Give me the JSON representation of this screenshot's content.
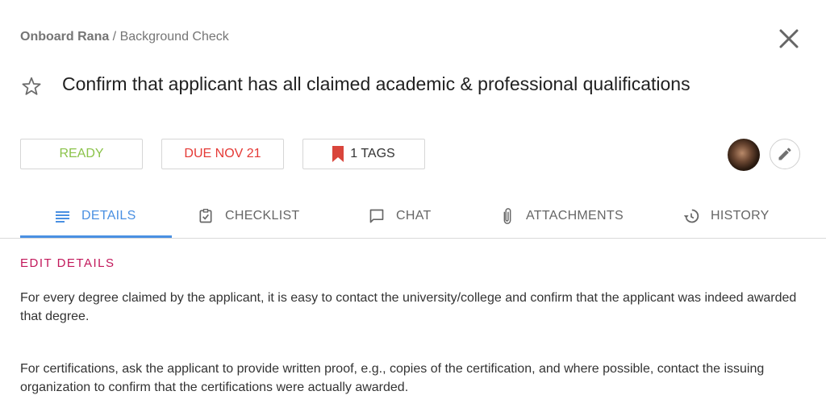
{
  "breadcrumb": {
    "parent": "Onboard Rana",
    "separator": " / ",
    "current": "Background Check"
  },
  "task": {
    "title": "Confirm that applicant has all claimed academic & professional qualifications",
    "starred": false
  },
  "chips": {
    "status": "READY",
    "due": "DUE NOV 21",
    "tags": "1 TAGS"
  },
  "colors": {
    "status_ready": "#8bc34a",
    "due": "#e53935",
    "tag_icon": "#d9453b",
    "active_tab": "#4a90e2",
    "section_label": "#c2185b"
  },
  "tabs": [
    {
      "label": "DETAILS",
      "icon": "details-lines-icon",
      "active": true
    },
    {
      "label": "CHECKLIST",
      "icon": "clipboard-check-icon",
      "active": false
    },
    {
      "label": "CHAT",
      "icon": "chat-bubble-icon",
      "active": false
    },
    {
      "label": "ATTACHMENTS",
      "icon": "paperclip-icon",
      "active": false
    },
    {
      "label": "HISTORY",
      "icon": "history-icon",
      "active": false
    }
  ],
  "details": {
    "edit_label": "EDIT DETAILS",
    "paragraphs": [
      "For every degree claimed by the applicant, it is easy to contact the university/college and confirm that the applicant was indeed awarded that degree.",
      "For certifications, ask the applicant to provide written proof, e.g., copies of the certification, and where possible, contact the issuing organization to confirm that the certifications were actually awarded."
    ]
  }
}
